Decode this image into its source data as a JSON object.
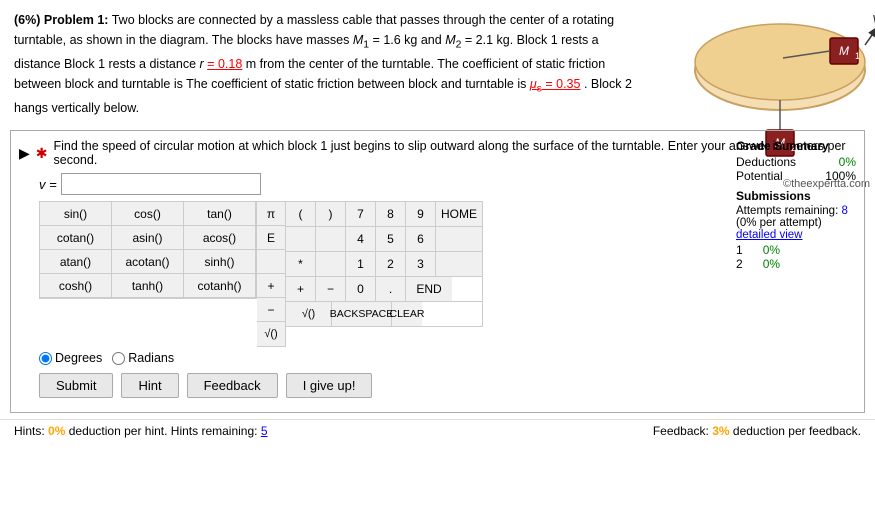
{
  "problem": {
    "header": "(6%) Problem 1:",
    "text": " Two blocks are connected by a massless cable that passes through the center of a rotating turntable, as shown in the diagram. The blocks have masses ",
    "m1_label": "M",
    "m1_sub": "1",
    "m1_val": " = 1.6 kg and ",
    "m2_label": "M",
    "m2_sub": "2",
    "m2_val": " = 2.1 kg. Block 1 rests a distance ",
    "r_label": "r",
    "r_val": " = 0.18",
    "r_unit": " m from the center of the turntable. The coefficient of static friction between block and turntable is ",
    "mu_label": "μ",
    "mu_val": "= 0.35",
    "mu_end": ". Block 2 hangs vertically below.",
    "copyright": "©theexpertta.com"
  },
  "question": {
    "text": "Find the speed of circular motion at which block 1 just begins to slip outward along the surface of the turntable. Enter your answer in meters per second.",
    "answer_label": "v =",
    "answer_placeholder": ""
  },
  "calculator": {
    "trig_buttons": [
      "sin()",
      "cos()",
      "tan()",
      "cotan()",
      "asin()",
      "acos()",
      "atan()",
      "acotan()",
      "sinh()",
      "cosh()",
      "tanh()",
      "cotanh()"
    ],
    "special_buttons": [
      "π",
      "E"
    ],
    "numpad": [
      [
        "(",
        ")",
        "7",
        "8",
        "9",
        "HOME"
      ],
      [
        "",
        "",
        "4",
        "5",
        "6",
        ""
      ],
      [
        "*",
        "1",
        "2",
        "3",
        ""
      ],
      [
        "+",
        "-",
        "0",
        ".",
        "END"
      ],
      [
        "√()",
        "BACKSPACE",
        "",
        "CLEAR"
      ]
    ],
    "degree_label": "Degrees",
    "radian_label": "Radians"
  },
  "action_buttons": {
    "submit": "Submit",
    "hint": "Hint",
    "feedback": "Feedback",
    "give_up": "I give up!"
  },
  "grade_summary": {
    "title": "Grade Summary",
    "deductions_label": "Deductions",
    "deductions_val": "0%",
    "potential_label": "Potential",
    "potential_val": "100%",
    "submissions_title": "Submissions",
    "attempts_label": "Attempts remaining:",
    "attempts_val": "8",
    "per_attempt": "(0% per attempt)",
    "detailed_label": "detailed view",
    "attempt1_num": "1",
    "attempt1_val": "0%",
    "attempt2_num": "2",
    "attempt2_val": "0%"
  },
  "hints": {
    "text": "Hints:",
    "deduction_pct": "0%",
    "deduction_label": " deduction per hint. Hints remaining:",
    "hints_remaining": "5",
    "feedback_label": "Feedback:",
    "feedback_pct": "3%",
    "feedback_deduction": " deduction per feedback."
  }
}
